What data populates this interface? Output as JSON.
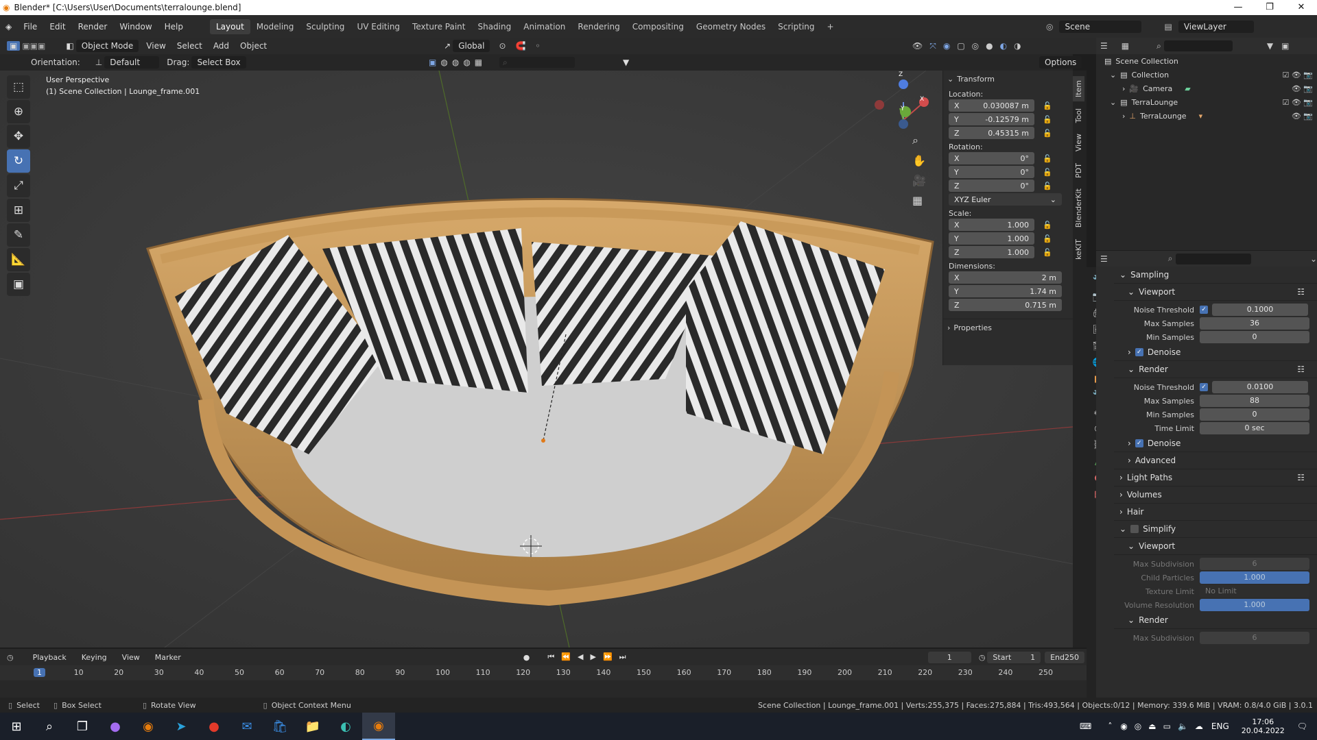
{
  "window": {
    "title": "Blender* [C:\\Users\\User\\Documents\\terralounge.blend]",
    "minimize": "—",
    "maximize": "❐",
    "close": "✕"
  },
  "menu": [
    "File",
    "Edit",
    "Render",
    "Window",
    "Help"
  ],
  "workspaces": [
    "Layout",
    "Modeling",
    "Sculpting",
    "UV Editing",
    "Texture Paint",
    "Shading",
    "Animation",
    "Rendering",
    "Compositing",
    "Geometry Nodes",
    "Scripting"
  ],
  "scene": {
    "scene_name": "Scene",
    "view_layer": "ViewLayer"
  },
  "header": {
    "mode": "Object Mode",
    "view": "View",
    "select": "Select",
    "add": "Add",
    "object": "Object",
    "transform_orientation": "Global",
    "orientation_label": "Orientation:",
    "orientation_value": "Default",
    "drag_label": "Drag:",
    "drag_value": "Select Box",
    "options": "Options"
  },
  "viewport": {
    "perspective": "User Perspective",
    "collection_info": "(1) Scene Collection | Lounge_frame.001",
    "gizmo_axes": [
      "X",
      "Y",
      "Z"
    ]
  },
  "npanel": {
    "transform_title": "Transform",
    "location_label": "Location:",
    "location": [
      {
        "axis": "X",
        "value": "0.030087 m"
      },
      {
        "axis": "Y",
        "value": "-0.12579 m"
      },
      {
        "axis": "Z",
        "value": "0.45315 m"
      }
    ],
    "rotation_label": "Rotation:",
    "rotation": [
      {
        "axis": "X",
        "value": "0°"
      },
      {
        "axis": "Y",
        "value": "0°"
      },
      {
        "axis": "Z",
        "value": "0°"
      }
    ],
    "rotation_mode": "XYZ Euler",
    "scale_label": "Scale:",
    "scale": [
      {
        "axis": "X",
        "value": "1.000"
      },
      {
        "axis": "Y",
        "value": "1.000"
      },
      {
        "axis": "Z",
        "value": "1.000"
      }
    ],
    "dimensions_label": "Dimensions:",
    "dimensions": [
      {
        "axis": "X",
        "value": "2 m"
      },
      {
        "axis": "Y",
        "value": "1.74 m"
      },
      {
        "axis": "Z",
        "value": "0.715 m"
      }
    ],
    "properties_title": "Properties",
    "tabs": [
      "Item",
      "Tool",
      "View",
      "PDT",
      "BlenderKit",
      "keKIT"
    ]
  },
  "outliner": {
    "root": "Scene Collection",
    "items": [
      {
        "label": "Collection",
        "indent": 1
      },
      {
        "label": "Camera",
        "indent": 2
      },
      {
        "label": "TerraLounge",
        "indent": 1
      },
      {
        "label": "TerraLounge",
        "indent": 2
      }
    ]
  },
  "properties": {
    "sampling": "Sampling",
    "viewport": "Viewport",
    "render": "Render",
    "noise_threshold_label": "Noise Threshold",
    "viewport_noise_threshold": "0.1000",
    "max_samples_label": "Max Samples",
    "viewport_max_samples": "36",
    "min_samples_label": "Min Samples",
    "viewport_min_samples": "0",
    "denoise": "Denoise",
    "render_noise_threshold": "0.0100",
    "render_max_samples": "88",
    "render_min_samples": "0",
    "time_limit_label": "Time Limit",
    "time_limit": "0 sec",
    "advanced": "Advanced",
    "light_paths": "Light Paths",
    "volumes": "Volumes",
    "hair": "Hair",
    "simplify": "Simplify",
    "max_subdivision_label": "Max Subdivision",
    "max_subdivision": "6",
    "child_particles_label": "Child Particles",
    "child_particles": "1.000",
    "texture_limit_label": "Texture Limit",
    "texture_limit": "No Limit",
    "volume_resolution_label": "Volume Resolution",
    "volume_resolution": "1.000",
    "render_max_subdivision": "6"
  },
  "timeline": {
    "playback": "Playback",
    "keying": "Keying",
    "view": "View",
    "marker": "Marker",
    "current_frame": "1",
    "start_label": "Start",
    "start": "1",
    "end_label": "End",
    "end": "250",
    "ticks": [
      "1",
      "10",
      "20",
      "30",
      "40",
      "50",
      "60",
      "70",
      "80",
      "90",
      "100",
      "110",
      "120",
      "130",
      "140",
      "150",
      "160",
      "170",
      "180",
      "190",
      "200",
      "210",
      "220",
      "230",
      "240",
      "250"
    ]
  },
  "status": {
    "select": "Select",
    "box_select": "Box Select",
    "rotate_view": "Rotate View",
    "context_menu": "Object Context Menu",
    "stats": "Scene Collection | Lounge_frame.001 | Verts:255,375 | Faces:275,884 | Tris:493,564 | Objects:0/12 | Memory: 339.6 MiB | VRAM: 0.8/4.0 GiB | 3.0.1"
  },
  "taskbar": {
    "lang": "ENG",
    "time": "17:06",
    "date": "20.04.2022"
  }
}
